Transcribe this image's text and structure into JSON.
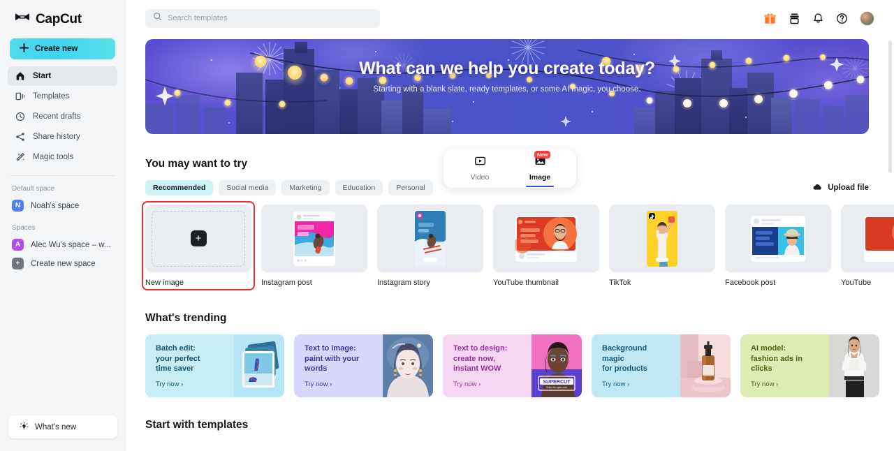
{
  "brand": {
    "name": "CapCut",
    "logo_icon": "capcut-logo-icon"
  },
  "sidebar": {
    "create_new": {
      "label": "Create new",
      "icon": "plus-icon"
    },
    "items": [
      {
        "label": "Start",
        "icon": "home-icon",
        "active": true
      },
      {
        "label": "Templates",
        "icon": "templates-icon",
        "active": false
      },
      {
        "label": "Recent drafts",
        "icon": "clock-icon",
        "active": false
      },
      {
        "label": "Share history",
        "icon": "share-icon",
        "active": false
      },
      {
        "label": "Magic tools",
        "icon": "magic-wand-icon",
        "active": false
      }
    ],
    "default_space_label": "Default space",
    "default_space": {
      "label": "Noah's space",
      "initial": "N",
      "color": "#4f7df8"
    },
    "spaces_label": "Spaces",
    "spaces": [
      {
        "label": "Alec Wu's space – w...",
        "initial": "A",
        "color": "#b44af0"
      },
      {
        "label": "Create new space",
        "initial": "+",
        "color": "#6f767e"
      }
    ],
    "whats_new": {
      "label": "What's new",
      "icon": "lightbulb-icon"
    }
  },
  "topbar": {
    "search": {
      "placeholder": "Search templates",
      "value": "",
      "icon": "search-icon"
    },
    "icons": [
      {
        "name": "gift-icon",
        "color": "#ff7a21"
      },
      {
        "name": "download-app-icon",
        "color": "#14161a"
      },
      {
        "name": "bell-icon",
        "color": "#14161a"
      },
      {
        "name": "help-circle-icon",
        "color": "#14161a"
      }
    ],
    "avatar": "user-avatar"
  },
  "hero": {
    "title": "What can we help you create today?",
    "subtitle": "Starting with a blank slate, ready templates, or some AI magic, you choose.",
    "bg_colors": {
      "left": "#5b4fd0",
      "mid": "#4a54c9",
      "right": "#5b4fce"
    }
  },
  "mode_toggle": {
    "items": [
      {
        "label": "Video",
        "icon": "video-play-icon",
        "selected": false,
        "badge": ""
      },
      {
        "label": "Image",
        "icon": "image-icon",
        "selected": true,
        "badge": "New"
      }
    ],
    "underline_color": "#3f51d8"
  },
  "try_section": {
    "title": "You may want to try",
    "chips": [
      {
        "label": "Recommended",
        "selected": true
      },
      {
        "label": "Social media",
        "selected": false
      },
      {
        "label": "Marketing",
        "selected": false
      },
      {
        "label": "Education",
        "selected": false
      },
      {
        "label": "Personal",
        "selected": false
      }
    ],
    "upload": {
      "label": "Upload file",
      "icon": "upload-cloud-icon"
    },
    "cards": [
      {
        "label": "New image",
        "type": "new",
        "selected": true
      },
      {
        "label": "Instagram post",
        "type": "instagram-post",
        "selected": false
      },
      {
        "label": "Instagram story",
        "type": "instagram-story",
        "selected": false
      },
      {
        "label": "YouTube thumbnail",
        "type": "youtube-thumbnail",
        "selected": false
      },
      {
        "label": "TikTok",
        "type": "tiktok",
        "selected": false
      },
      {
        "label": "Facebook post",
        "type": "facebook-post",
        "selected": false
      },
      {
        "label": "YouTube",
        "type": "youtube",
        "selected": false
      }
    ],
    "selection_color": "#ef2b2b",
    "next_arrow": "›"
  },
  "trending_section": {
    "title": "What's trending",
    "try_now": "Try now ›",
    "cards": [
      {
        "title": "Batch edit:\nyour perfect\ntime saver",
        "bg": "#c7eef7",
        "text_color": "#15566e",
        "img": "shoes-stack"
      },
      {
        "title": "Text to image:\npaint with your\nwords",
        "bg": "#d9d6fb",
        "text_color": "#40359b",
        "img": "ai-portrait"
      },
      {
        "title": "Text to design:\ncreate now,\ninstant WOW",
        "bg": "#f6d7f3",
        "text_color": "#9d2fa0",
        "img": "supercut-poster"
      },
      {
        "title": "Background\nmagic\nfor products",
        "bg": "#bfe8f5",
        "text_color": "#14597a",
        "img": "bottle-product"
      },
      {
        "title": "AI model:\nfashion ads in\nclicks",
        "bg": "#dcecb3",
        "text_color": "#4f6314",
        "img": "fashion-model"
      }
    ],
    "next_arrow": "›"
  },
  "templates_section": {
    "title": "Start with templates"
  }
}
